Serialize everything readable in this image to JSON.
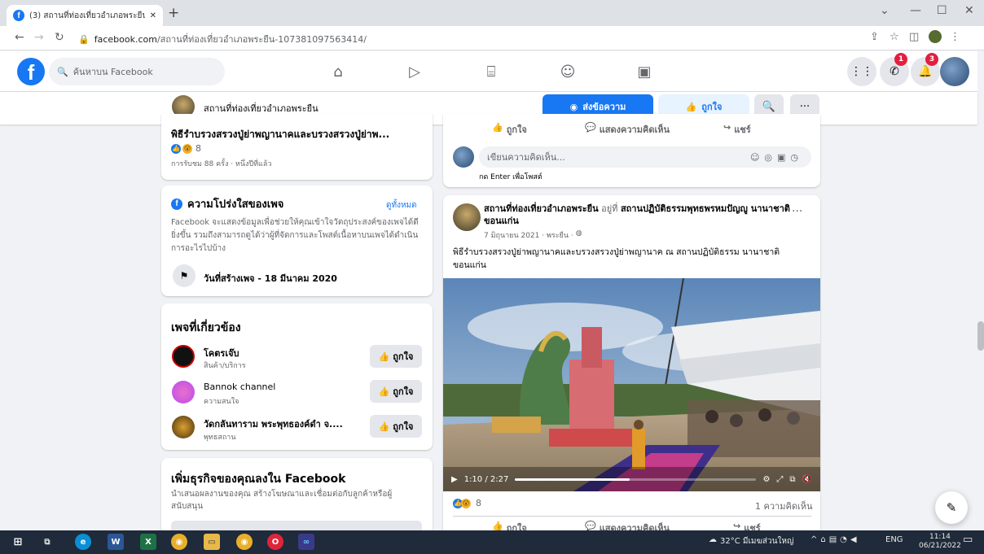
{
  "browser": {
    "tab_title": "(3) สถานที่ท่องเที่ยวอำเภอพระยืน | Fa",
    "url_domain": "facebook.com",
    "url_path": "/สถานที่ท่องเที่ยวอำเภอพระยืน-107381097563414/"
  },
  "header": {
    "search_placeholder": "ค้นหาบน Facebook",
    "messenger_badge": "1",
    "notif_badge": "3"
  },
  "pagebar": {
    "page_name": "สถานที่ท่องเที่ยวอำเภอพระยืน",
    "message_label": "ส่งข้อความ",
    "like_label": "ถูกใจ"
  },
  "left": {
    "post_title": "พิธีรำบรวงสรวงปู่ย่าพญานาคและบรวงสรวงปู่ย่าพ...",
    "post_reactions": "8",
    "post_meta": "การรับชม 88 ครั้ง · หนึ่งปีที่แล้ว",
    "transparency": {
      "title": "ความโปร่งใสของเพจ",
      "see_all": "ดูทั้งหมด",
      "body": "Facebook จะแสดงข้อมูลเพื่อช่วยให้คุณเข้าใจวัตถุประสงค์ของเพจได้ดียิ่งขึ้น รวมถึงสามารถดูได้ว่าผู้ที่จัดการและโพสต์เนื้อหาบนเพจได้ดำเนินการอะไรไปบ้าง",
      "created": "วันที่สร้างเพจ - 18 มีนาคม 2020"
    },
    "related": {
      "title": "เพจที่เกี่ยวข้อง",
      "like_label": "ถูกใจ",
      "items": [
        {
          "name": "โคตรเจ๊บ",
          "category": "สินค้า/บริการ"
        },
        {
          "name": "Bannok channel",
          "category": "ความสนใจ"
        },
        {
          "name": "วัดกลันทาราม พระพุทธองค์ดำ จ....",
          "category": "พุทธสถาน"
        }
      ]
    },
    "business": {
      "title": "เพิ่มธุรกิจของคุณลงใน Facebook",
      "body": "นำเสนอผลงานของคุณ สร้างโฆษณาและเชื่อมต่อกับลูกค้าหรือผู้สนับสนุน"
    }
  },
  "right": {
    "top_actions": [
      "ถูกใจ",
      "แสดงความคิดเห็น",
      "แชร์"
    ],
    "comment_placeholder": "เขียนความคิดเห็น...",
    "enter_hint": "กด Enter เพื่อโพสต์",
    "post": {
      "author": "สถานที่ท่องเที่ยวอำเภอพระยืน",
      "at_word": "อยู่ที่",
      "location": "สถานปฏิบัติธรรมพุทธพรหมปัญญู นานาชาติ ขอนแก่น",
      "date": "7 มิถุนายน 2021 · พระยืน ·",
      "caption": "พิธีรำบรวงสรวงปู่ย่าพญานาคและบรวงสรวงปู่ย่าพญานาค ณ สถานปฏิบัติธรรม นานาชาติ ขอนแก่น",
      "video_time": "1:10 / 2:27",
      "video_progress": 0.476,
      "reactions": "8",
      "comments": "1 ความคิดเห็น",
      "actions": [
        "ถูกใจ",
        "แสดงความคิดเห็น",
        "แชร์"
      ]
    }
  },
  "taskbar": {
    "weather": "32°C มีเมฆส่วนใหญ่",
    "lang": "ENG",
    "time": "11:14",
    "date": "06/21/2022"
  }
}
